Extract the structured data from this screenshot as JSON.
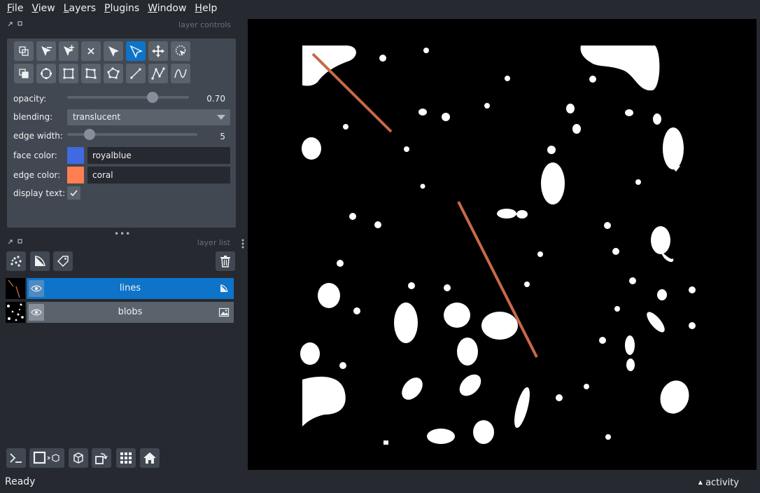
{
  "menubar": {
    "items": [
      {
        "label": "File",
        "mnemonic": "F",
        "rest": "ile"
      },
      {
        "label": "View",
        "mnemonic": "V",
        "rest": "iew"
      },
      {
        "label": "Layers",
        "mnemonic": "L",
        "rest": "ayers"
      },
      {
        "label": "Plugins",
        "mnemonic": "P",
        "rest": "lugins"
      },
      {
        "label": "Window",
        "mnemonic": "W",
        "rest": "indow"
      },
      {
        "label": "Help",
        "mnemonic": "H",
        "rest": "elp"
      }
    ]
  },
  "layer_controls": {
    "title": "layer controls",
    "opacity_label": "opacity:",
    "opacity_value": "0.70",
    "opacity_fraction": 0.7,
    "blending_label": "blending:",
    "blending_value": "translucent",
    "edge_width_label": "edge width:",
    "edge_width_value": "5",
    "edge_width_fraction": 0.17,
    "face_color_label": "face color:",
    "face_color_value": "royalblue",
    "face_color_hex": "#4169e1",
    "edge_color_label": "edge color:",
    "edge_color_value": "coral",
    "edge_color_hex": "#ff7f50",
    "display_text_label": "display text:",
    "display_text_checked": true
  },
  "layer_list": {
    "title": "layer list",
    "layers": [
      {
        "name": "lines",
        "type": "shapes",
        "selected": true
      },
      {
        "name": "blobs",
        "type": "image",
        "selected": false
      }
    ]
  },
  "status": {
    "text": "Ready",
    "activity_label": "activity"
  },
  "colors": {
    "background": "#262930",
    "panel": "#414851",
    "button": "#5a626c",
    "accent": "#0d74c9",
    "line_color": "#c8694a"
  }
}
